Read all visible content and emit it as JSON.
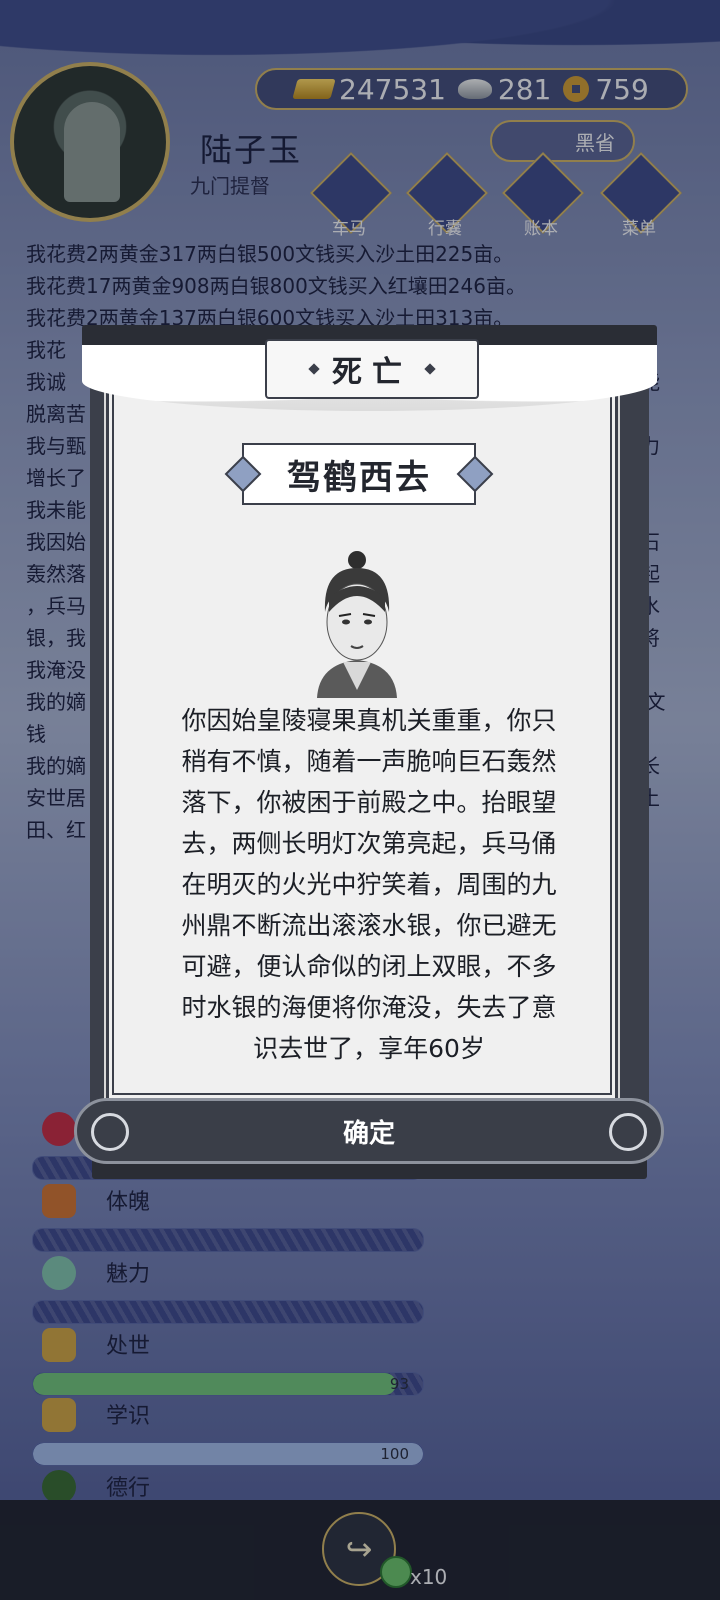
{
  "player": {
    "name": "陆子玉",
    "title": "九门提督"
  },
  "currency": {
    "gold": "247531",
    "silver": "281",
    "coins": "759"
  },
  "season": {
    "label": "黑省"
  },
  "menu": [
    {
      "label": "车马"
    },
    {
      "label": "行囊"
    },
    {
      "label": "账本"
    },
    {
      "label": "菜单"
    }
  ],
  "log": [
    "我花费2两黄金317两白银500文钱买入沙土田225亩。",
    "我花费17两黄金908两白银800文钱买入红壤田246亩。",
    "我花费2两黄金137两白银600文钱买入沙土田313亩。",
    "我花",
    "我诚",
    "脱离苦",
    "我与甄",
    "增长了",
    "我未能",
    "我因始",
    "轰然落",
    "，兵马",
    "银，我",
    "我淹没",
    "我的嫡",
    "钱",
    "我的嫡",
    "安世居",
    "田、红"
  ],
  "log_right": [
    "她能",
    "能力",
    "巨石",
    "亮起",
    "滚水",
    "便将",
    "59文",
    "、长",
    "黄土"
  ],
  "attributes": [
    {
      "name": "",
      "value": ""
    },
    {
      "name": "体魄",
      "value": ""
    },
    {
      "name": "魅力",
      "value": ""
    },
    {
      "name": "处世",
      "value": "93",
      "fill": 0.93
    },
    {
      "name": "学识",
      "value": "100",
      "fill": 1.0
    },
    {
      "name": "德行",
      "value": ""
    }
  ],
  "bottom": {
    "multiplier": "x10"
  },
  "dialog": {
    "title": "死亡",
    "subtitle": "驾鹤西去",
    "story_lines": [
      "你因始皇陵寝果真机关重重，你只",
      "稍有不慎，随着一声脆响巨石轰然",
      "落下，你被困于前殿之中。抬眼望",
      "去，两侧长明灯次第亮起，兵马俑",
      "在明灭的火光中狞笑着，周围的九",
      "州鼎不断流出滚滚水银，你已避无",
      "可避，便认命似的闭上双眼，不多",
      "时水银的海便将你淹没，失去了意",
      "识去世了，享年60岁"
    ],
    "confirm_label": "确定"
  },
  "colors": {
    "accent_gold": "#c9b06a",
    "dialog_dark": "#3b3f4a",
    "bar_green": "#6fbf7e",
    "bar_blue": "#9fb7e6"
  }
}
